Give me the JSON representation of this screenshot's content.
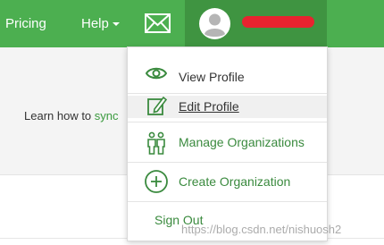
{
  "topbar": {
    "pricing_label": "Pricing",
    "help_label": "Help"
  },
  "content": {
    "learn_prefix": "Learn how to ",
    "learn_link": "sync"
  },
  "profile_menu": {
    "items": [
      {
        "label": "View Profile",
        "icon": "eye-icon"
      },
      {
        "label": "Edit Profile",
        "icon": "edit-icon"
      },
      {
        "label": "Manage Organizations",
        "icon": "people-icon"
      },
      {
        "label": "Create Organization",
        "icon": "plus-circle-icon"
      },
      {
        "label": "Sign Out"
      }
    ]
  },
  "watermark": "https://blog.csdn.net/nishuosh2",
  "colors": {
    "topbar": "#4caf50",
    "profile_button": "#3f9441",
    "menu_accent": "#3a8a3e",
    "redaction": "#e8232f"
  }
}
